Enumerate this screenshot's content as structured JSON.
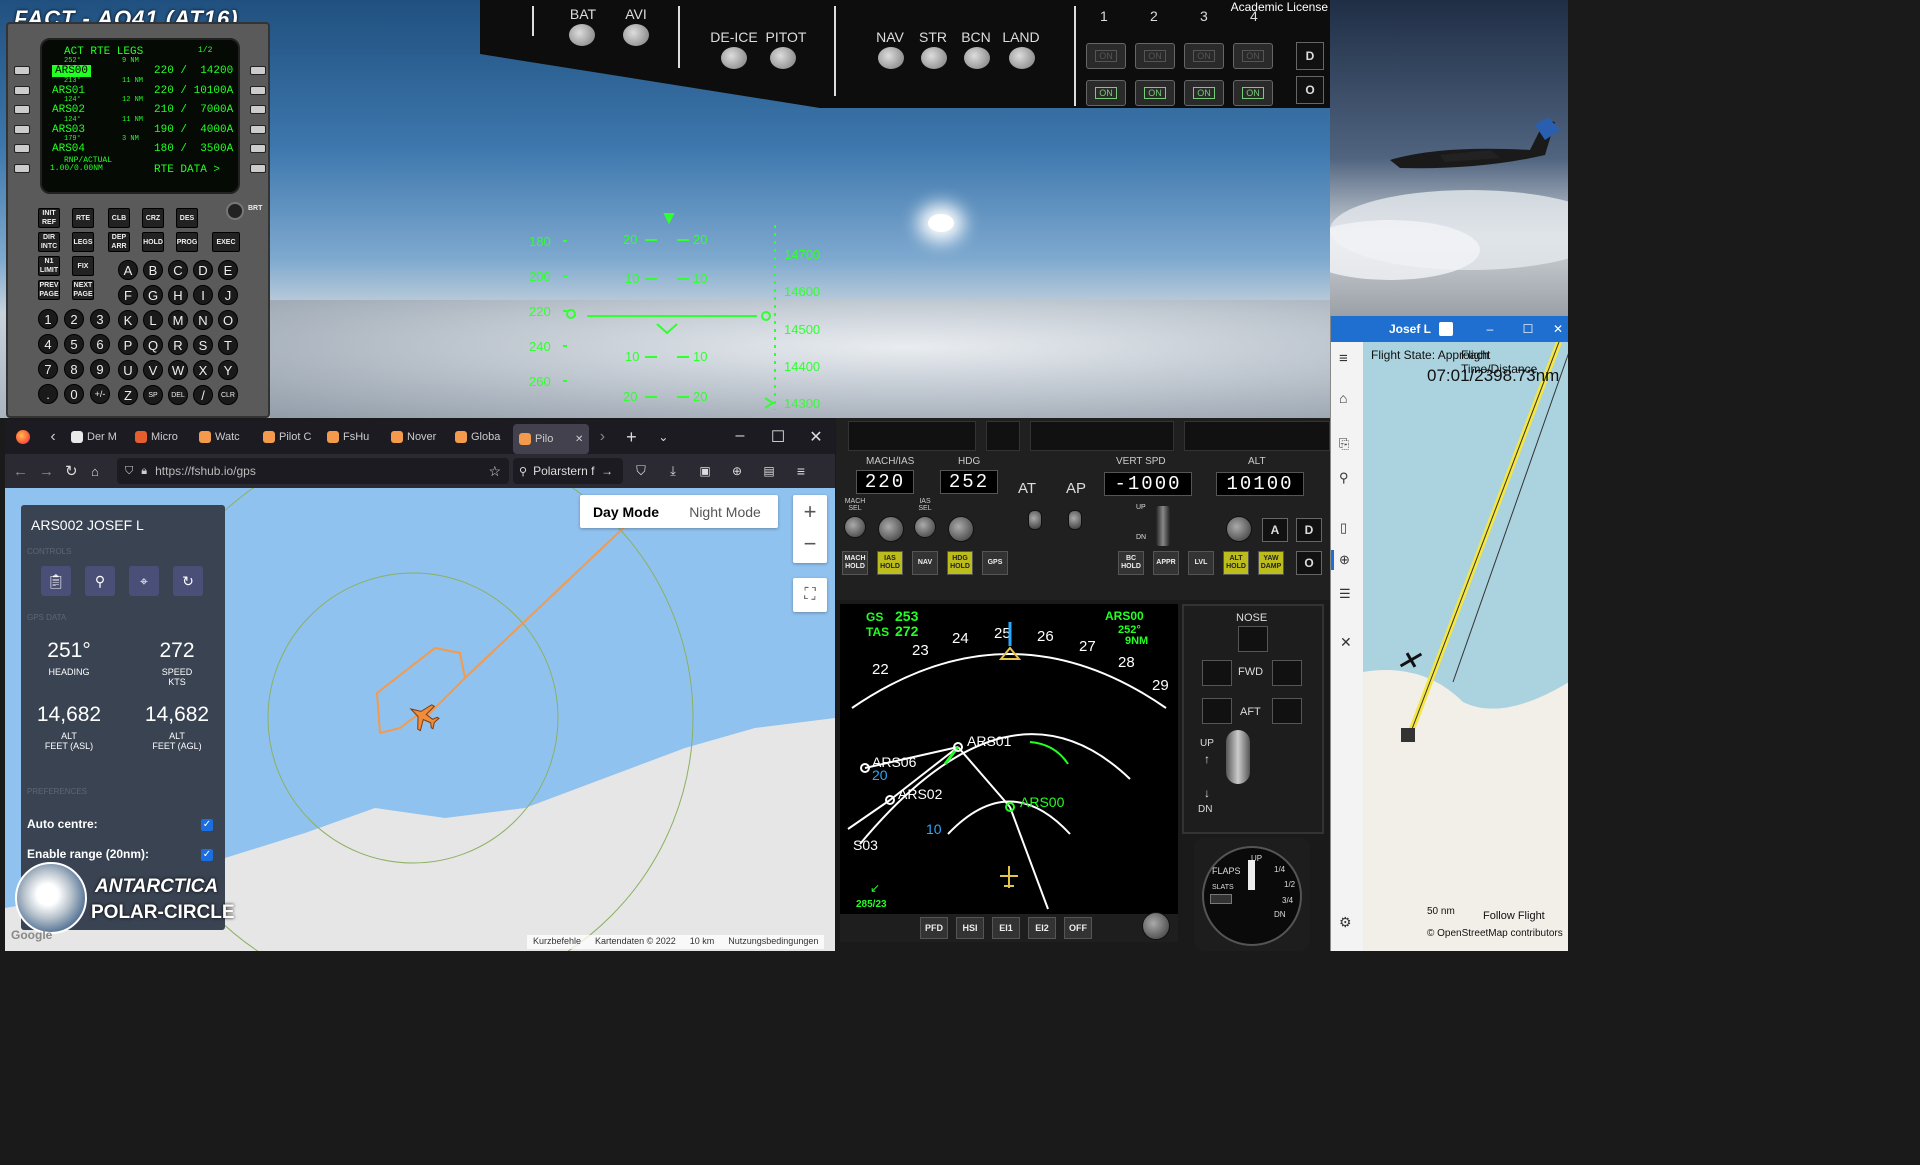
{
  "sim": {
    "title": "FACT - AQ41 (AT16)",
    "license": "Academic License",
    "switches": [
      {
        "label": "BAT"
      },
      {
        "label": "AVI"
      },
      {
        "label": "DE-ICE"
      },
      {
        "label": "PITOT"
      },
      {
        "label": "NAV"
      },
      {
        "label": "STR"
      },
      {
        "label": "BCN"
      },
      {
        "label": "LAND"
      }
    ],
    "engine_numbers": [
      "1",
      "2",
      "3",
      "4"
    ],
    "on_label": "ON",
    "side_buttons": [
      "D",
      "O"
    ]
  },
  "cdu": {
    "title": "ACT RTE  LEGS",
    "page": "1/2",
    "legs": [
      {
        "course": "252°",
        "dist": "9 NM",
        "wpt": "ARS00",
        "restr": "220 /  14200"
      },
      {
        "course": "213°",
        "dist": "11 NM",
        "wpt": "ARS01",
        "restr": "220 / 10100A"
      },
      {
        "course": "124°",
        "dist": "12 NM",
        "wpt": "ARS02",
        "restr": "210 /  7000A"
      },
      {
        "course": "124°",
        "dist": "11 NM",
        "wpt": "ARS03",
        "restr": "190 /  4000A"
      },
      {
        "course": "179°",
        "dist": "3 NM",
        "wpt": "ARS04",
        "restr": "180 /  3500A"
      }
    ],
    "rnp_label": "RNP/ACTUAL",
    "rnp_value": "1.00/0.00NM",
    "rte_data": "RTE DATA >",
    "brt": "BRT",
    "func_keys": [
      "INIT REF",
      "RTE",
      "CLB",
      "CRZ",
      "DES",
      "DIR INTC",
      "LEGS",
      "DEP ARR",
      "HOLD",
      "PROG",
      "EXEC",
      "N1 LIMIT",
      "FIX",
      "PREV PAGE",
      "NEXT PAGE"
    ],
    "alpha_keys": [
      "A",
      "B",
      "C",
      "D",
      "E",
      "F",
      "G",
      "H",
      "I",
      "J",
      "K",
      "L",
      "M",
      "N",
      "O",
      "P",
      "Q",
      "R",
      "S",
      "T",
      "U",
      "V",
      "W",
      "X",
      "Y",
      "Z",
      "SP",
      "DEL",
      "/",
      "CLR"
    ],
    "num_keys": [
      "1",
      "2",
      "3",
      "4",
      "5",
      "6",
      "7",
      "8",
      "9",
      ".",
      "0",
      "+/-"
    ]
  },
  "hud": {
    "speed_ticks": [
      "180",
      "200",
      "220",
      "240",
      "260"
    ],
    "alt_ticks": [
      "14700",
      "14600",
      "14500",
      "14400",
      "14300"
    ],
    "pitch_left": [
      "20",
      "10",
      "10",
      "20"
    ],
    "pitch_right": [
      "20",
      "10",
      "10",
      "20"
    ]
  },
  "browser": {
    "tabs": [
      {
        "label": "Der M"
      },
      {
        "label": "Micro"
      },
      {
        "label": "Watc"
      },
      {
        "label": "Pilot C"
      },
      {
        "label": "FsHu"
      },
      {
        "label": "Nover"
      },
      {
        "label": "Globa"
      },
      {
        "label": "Pilo"
      }
    ],
    "url": "https://fshub.io/gps",
    "search": "Polarstern fi",
    "mode_day": "Day Mode",
    "mode_night": "Night Mode",
    "zoom_in": "+",
    "zoom_out": "−",
    "flight_name": "ARS002 JOSEF L",
    "section_controls": "CONTROLS",
    "section_gps": "GPS DATA",
    "section_prefs": "PREFERENCES",
    "heading_value": "251°",
    "heading_label": "HEADING",
    "speed_value": "272",
    "speed_label": "SPEED",
    "speed_unit": "KTS",
    "alt_asl_value": "14,682",
    "alt_asl_label": "ALT",
    "alt_asl_unit": "FEET (ASL)",
    "alt_agl_value": "14,682",
    "alt_agl_label": "ALT",
    "alt_agl_unit": "FEET (AGL)",
    "auto_centre": "Auto centre:",
    "enable_range": "Enable range (20nm):",
    "logo_line1": "ANTARCTICA",
    "logo_line2": "POLAR-CIRCLE",
    "google": "Google",
    "footer_shortcuts": "Kurzbefehle",
    "footer_mapdata": "Kartendaten © 2022",
    "footer_scale": "10 km",
    "footer_terms": "Nutzungsbedingungen"
  },
  "mcp": {
    "ias_label": "MACH/IAS",
    "ias_value": "220",
    "hdg_label": "HDG",
    "hdg_value": "252",
    "at_label": "AT",
    "ap_label": "AP",
    "vs_label": "VERT SPD",
    "vs_value": "-1000",
    "alt_label": "ALT",
    "alt_value": "10100",
    "mach_sel": "MACH SEL",
    "ias_sel": "IAS SEL",
    "up": "UP",
    "dn": "DN",
    "buttons_left": [
      {
        "label": "MACH HOLD",
        "on": false
      },
      {
        "label": "IAS HOLD",
        "on": true
      },
      {
        "label": "NAV",
        "on": false
      },
      {
        "label": "HDG HOLD",
        "on": true
      },
      {
        "label": "GPS",
        "on": false
      }
    ],
    "buttons_right": [
      {
        "label": "BC HOLD",
        "on": false
      },
      {
        "label": "APPR",
        "on": false
      },
      {
        "label": "LVL",
        "on": false
      },
      {
        "label": "ALT HOLD",
        "on": true
      },
      {
        "label": "YAW DAMP",
        "on": true
      }
    ],
    "btn_a": "A",
    "btn_d": "D",
    "btn_o": "O"
  },
  "nd": {
    "gs_label": "GS",
    "gs_value": "253",
    "tas_label": "TAS",
    "tas_value": "272",
    "next_wpt": "ARS00",
    "next_crs": "252°",
    "next_dist": "9NM",
    "compass": [
      "22",
      "23",
      "24",
      "25",
      "26",
      "27",
      "28",
      "29"
    ],
    "waypoints": [
      "ARS01",
      "ARS00",
      "ARS02",
      "ARS06",
      "S03"
    ],
    "range_outer": "20",
    "range_inner": "10",
    "wind": "285/23",
    "buttons": [
      "PFD",
      "HSI",
      "EI1",
      "EI2",
      "OFF"
    ]
  },
  "gear": {
    "nose": "NOSE",
    "fwd": "FWD",
    "aft": "AFT",
    "up": "UP",
    "dn": "DN"
  },
  "flaps": {
    "label": "FLAPS",
    "slats": "SLATS",
    "marks": [
      "UP",
      "1/4",
      "1/2",
      "3/4",
      "DN"
    ]
  },
  "app": {
    "title": "Josef L",
    "flight_state": "Flight State: Approach",
    "time_label": "Flight Time/Distance",
    "time_value": "07:01/2398.73nm",
    "follow": "Follow Flight",
    "scale": "50 nm",
    "attrib": "© OpenStreetMap contributors"
  }
}
